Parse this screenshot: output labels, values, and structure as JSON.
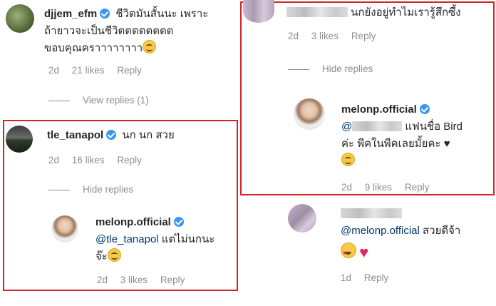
{
  "comments": {
    "c1": {
      "username": "djjem_efm",
      "text_line1": "ชีวิตมันสั้นนะ เพราะ",
      "text_line2": "ถ้ายาวจะเป็นชีวิตตตตตตตต",
      "text_line3": "ขอบคุณคราาาาาาาา",
      "time": "2d",
      "likes": "21 likes",
      "reply": "Reply",
      "view_replies": "View replies (1)"
    },
    "c2": {
      "username": "tle_tanapol",
      "text": "นก นก สวย",
      "time": "2d",
      "likes": "16 likes",
      "reply": "Reply",
      "hide_replies": "Hide replies",
      "reply_item": {
        "username": "melonp.official",
        "mention": "@tle_tanapol",
        "text_line1": " แต่ไม่นกนะ",
        "text_line2": "จ๊ะ",
        "time": "2d",
        "likes": "3 likes",
        "reply": "Reply"
      }
    },
    "c3": {
      "text": "นกยังอยู่ทำไมเรารู้สึกซึ้ง",
      "time": "2d",
      "likes": "3 likes",
      "reply": "Reply",
      "hide_replies": "Hide replies",
      "reply_item": {
        "username": "melonp.official",
        "mention": "@",
        "text_line1": " แฟนชื่อ Bird",
        "text_line2": "ค่ะ พีคในพีคเลยมั้ยคะ ♥",
        "time": "2d",
        "likes": "9 likes",
        "reply": "Reply"
      }
    },
    "c4": {
      "mention": "@melonp.official",
      "text": " สวยดีจ้า",
      "time": "1d",
      "reply": "Reply"
    }
  },
  "colors": {
    "highlight_border": "#d0242a",
    "verified": "#3897f0",
    "mention": "#00376b",
    "meta": "#8e8e8e"
  }
}
